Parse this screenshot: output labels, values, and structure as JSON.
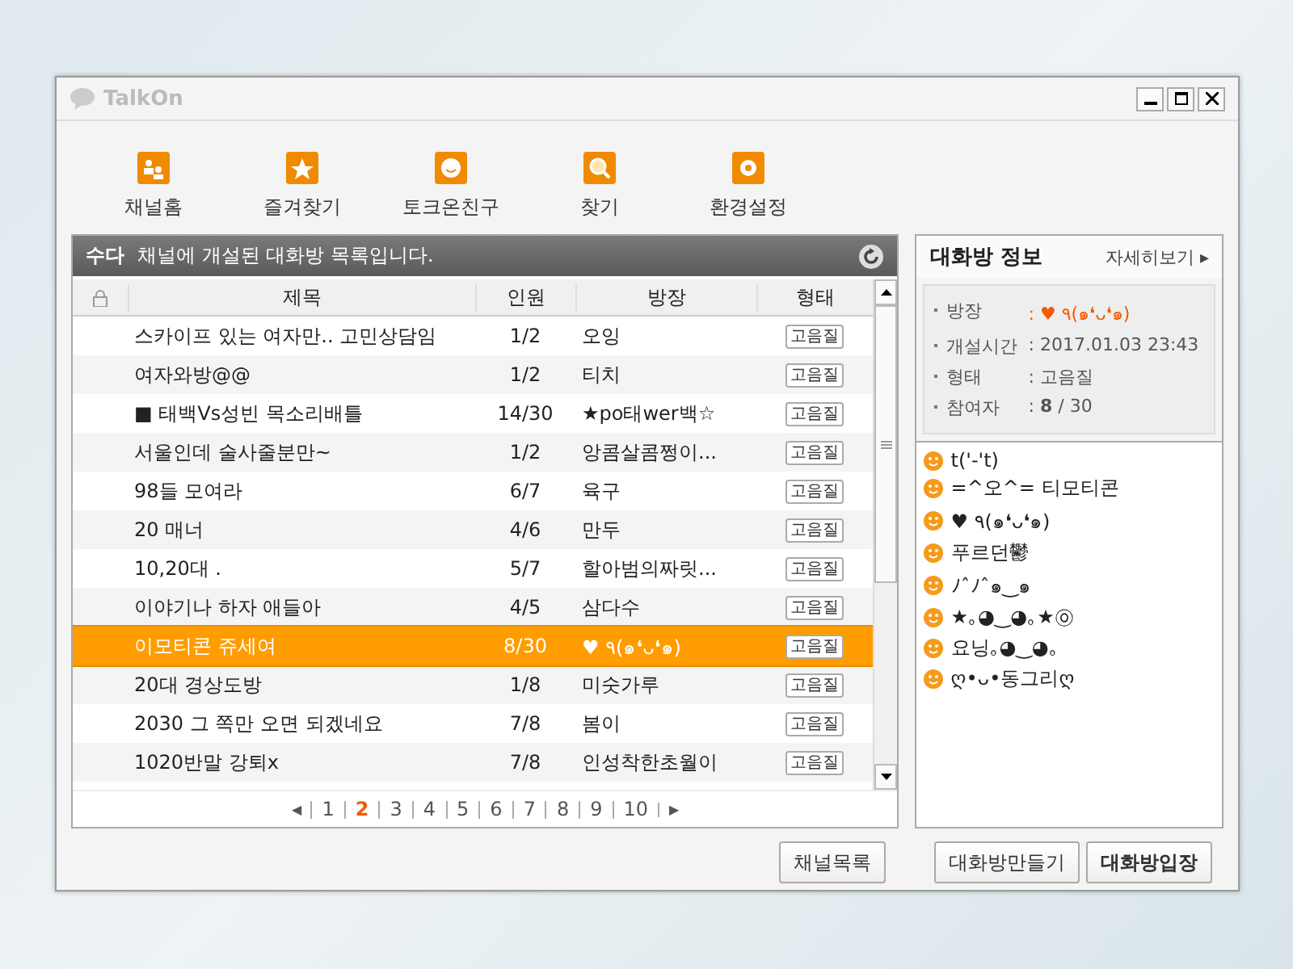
{
  "window": {
    "title": "TalkOn"
  },
  "toolbar": [
    {
      "label": "채널홈"
    },
    {
      "label": "즐겨찾기"
    },
    {
      "label": "토크온친구"
    },
    {
      "label": "찾기"
    },
    {
      "label": "환경설정"
    }
  ],
  "channel_header": {
    "channel": "수다",
    "text": "채널에 개설된 대화방 목록입니다."
  },
  "table": {
    "columns": [
      "제목",
      "인원",
      "방장",
      "형태"
    ],
    "rows": [
      {
        "title": "스카이프 있는 여자만.. 고민상담임",
        "count": "1/2",
        "host": "오잉",
        "type": "고음질",
        "selected": false
      },
      {
        "title": "여자와방@@",
        "count": "1/2",
        "host": "티치",
        "type": "고음질",
        "selected": false
      },
      {
        "title": "■ 태백Vs성빈 목소리배틀",
        "count": "14/30",
        "host": "★po태wer백☆",
        "type": "고음질",
        "selected": false
      },
      {
        "title": "서울인데 술사줄분만~",
        "count": "1/2",
        "host": "앙콤살콤쩡이...",
        "type": "고음질",
        "selected": false
      },
      {
        "title": "98들 모여라",
        "count": "6/7",
        "host": "육구",
        "type": "고음질",
        "selected": false
      },
      {
        "title": "20 매너",
        "count": "4/6",
        "host": "만두",
        "type": "고음질",
        "selected": false
      },
      {
        "title": "10,20대 .",
        "count": "5/7",
        "host": "할아범의짜릿...",
        "type": "고음질",
        "selected": false
      },
      {
        "title": "이야기나 하자 애들아",
        "count": "4/5",
        "host": "삼다수",
        "type": "고음질",
        "selected": false
      },
      {
        "title": "이모티콘 쥬세여",
        "count": "8/30",
        "host": "♥ ٩(๑❛ᴗ❛๑)",
        "type": "고음질",
        "selected": true
      },
      {
        "title": "20대 경상도방",
        "count": "1/8",
        "host": "미숫가루",
        "type": "고음질",
        "selected": false
      },
      {
        "title": "2030 그 쪽만 오면 되겠네요",
        "count": "7/8",
        "host": "봄이",
        "type": "고음질",
        "selected": false
      },
      {
        "title": "1020반말 강퇴x",
        "count": "7/8",
        "host": "인성착한초월이",
        "type": "고음질",
        "selected": false
      }
    ]
  },
  "pagination": {
    "prev": "◀",
    "next": "▶",
    "pages": [
      {
        "label": "1",
        "selected": false
      },
      {
        "label": "2",
        "selected": true
      },
      {
        "label": "3",
        "selected": false
      },
      {
        "label": "4",
        "selected": false
      },
      {
        "label": "5",
        "selected": false
      },
      {
        "label": "6",
        "selected": false
      },
      {
        "label": "7",
        "selected": false
      },
      {
        "label": "8",
        "selected": false
      },
      {
        "label": "9",
        "selected": false
      },
      {
        "label": "10",
        "selected": false
      }
    ]
  },
  "room_info": {
    "title": "대화방 정보",
    "more": "자세히보기 ▸",
    "fields": [
      {
        "label": "방장",
        "value": ": ♥ ٩(๑❛ᴗ❛๑)",
        "kind": "host"
      },
      {
        "label": "개설시간",
        "value": ": 2017.01.03 23:43",
        "kind": "plain"
      },
      {
        "label": "형태",
        "value": ": 고음질",
        "kind": "plain"
      },
      {
        "label": "참여자",
        "value": ": **8** / 30",
        "kind": "plain"
      }
    ],
    "participants": [
      "t('-'t)",
      "=^오^= 티모티콘",
      "♥ ٩(๑❛ᴗ❛๑)",
      "푸르던鬱",
      "ﾉˆﾉˆ๑‿๑",
      "★｡◕‿◕｡★㉧",
      "요닝｡◕‿◕｡",
      "ღ•ᴗ•동그리ღ"
    ]
  },
  "buttons": {
    "left": [
      "채널목록"
    ],
    "right": [
      {
        "label": "대화방만들기",
        "primary": false
      },
      {
        "label": "대화방입장",
        "primary": true
      }
    ]
  }
}
